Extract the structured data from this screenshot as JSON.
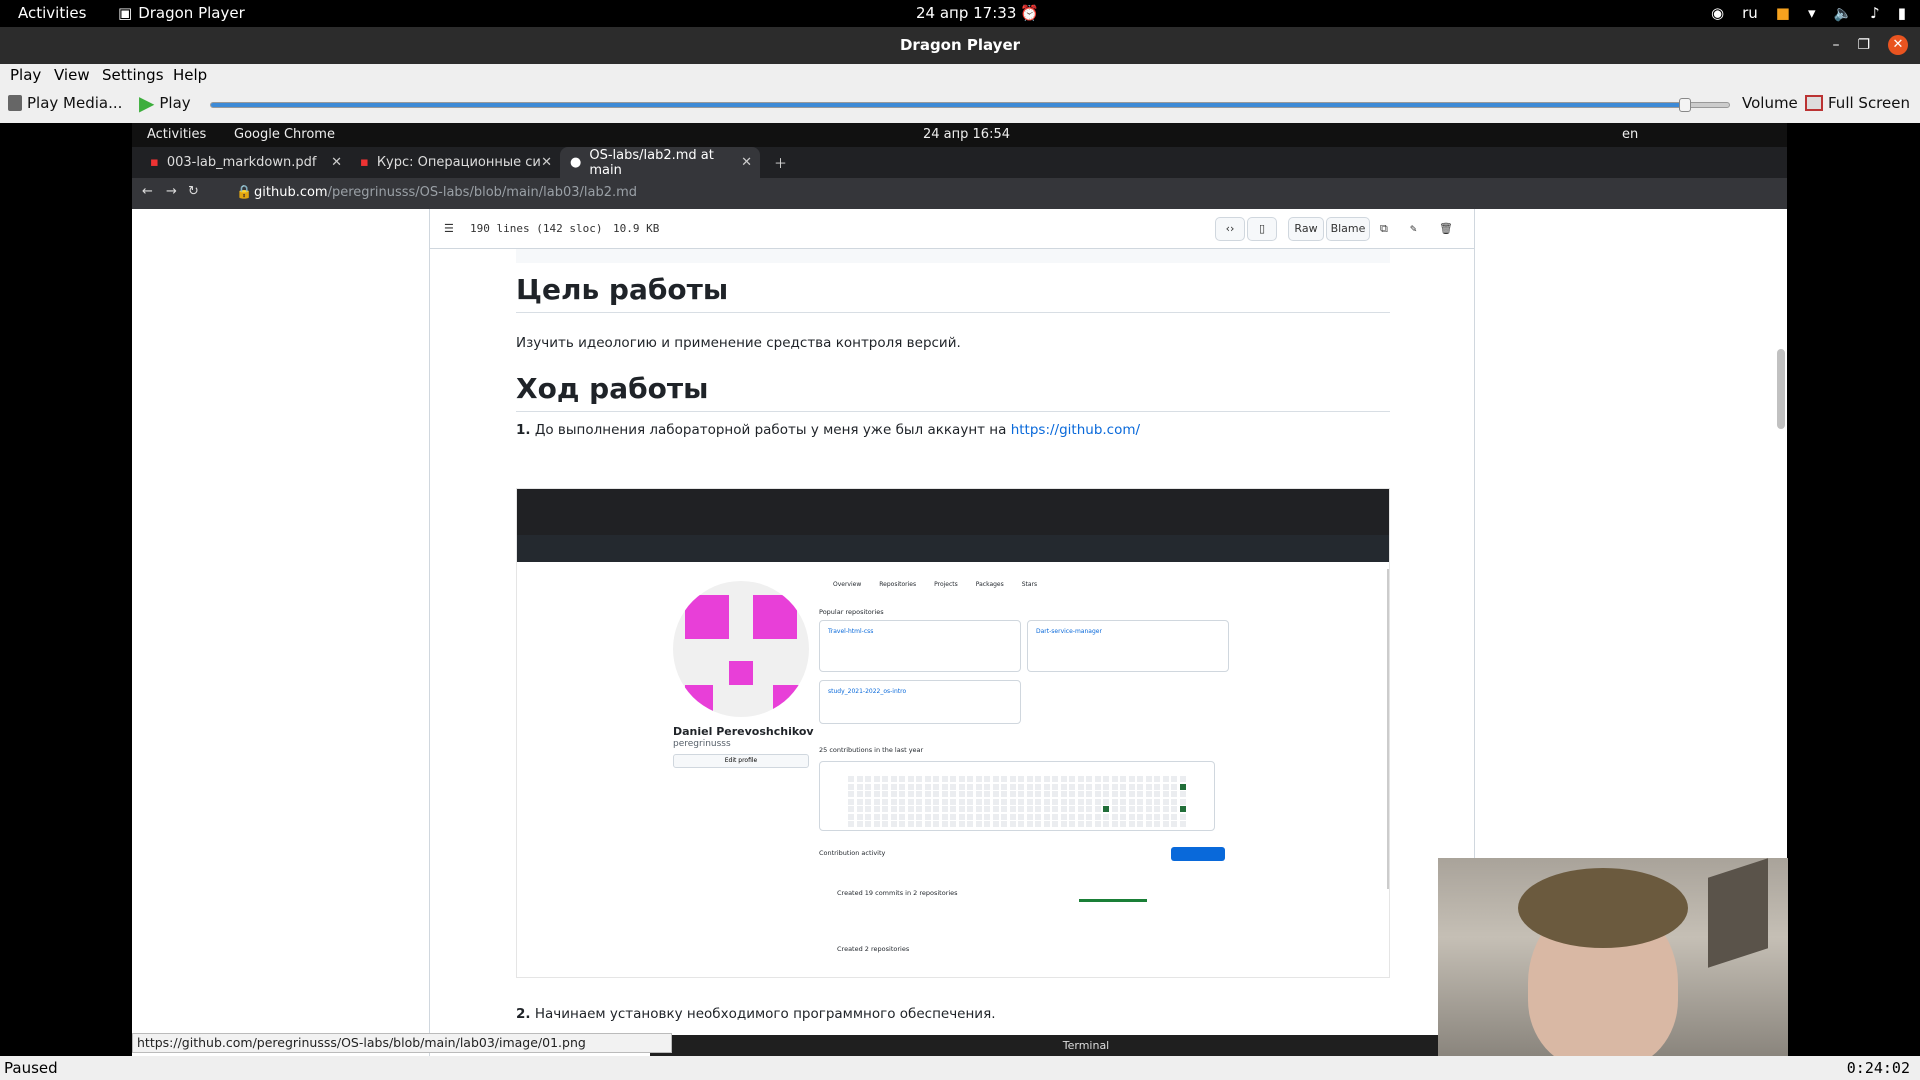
{
  "system": {
    "activities": "Activities",
    "app_name": "Dragon Player",
    "clock": "24 апр  17:33",
    "lang": "ru"
  },
  "window": {
    "title": "Dragon Player"
  },
  "menu": {
    "play": "Play",
    "view": "View",
    "settings": "Settings",
    "help": "Help"
  },
  "toolbar": {
    "play_media": "Play Media...",
    "play": "Play",
    "volume": "Volume",
    "fullscreen": "Full Screen",
    "seek_progress": 0.971
  },
  "status": {
    "state": "Paused",
    "time": "0:24:02"
  },
  "video": {
    "system": {
      "activities": "Activities",
      "browser": "Google Chrome",
      "clock": "24 апр  16:54",
      "lang": "en"
    },
    "tabs": [
      {
        "label": "003-lab_markdown.pdf"
      },
      {
        "label": "Курс: Операционные си"
      },
      {
        "label": "OS-labs/lab2.md at main"
      }
    ],
    "url": {
      "host": "github.com",
      "path": "/peregrinusss/OS-labs/blob/main/lab03/lab2.md"
    },
    "file": {
      "lines": "190 lines (142 sloc)",
      "size": "10.9 KB",
      "raw": "Raw",
      "blame": "Blame"
    },
    "doc": {
      "h_goal": "Цель работы",
      "goal_text": "Изучить идеологию и применение средства контроля версий.",
      "h_progress": "Ход работы",
      "step1_num": "1.",
      "step1_text": "До выполнения лабораторной работы у меня уже был аккаунт на",
      "step1_link": "https://github.com/",
      "step2_num": "2.",
      "step2_text": "Начинаем установку необходимого программного обеспечения."
    },
    "screenshot": {
      "profile_name": "Daniel Perevoshchikov",
      "profile_login": "peregrinusss",
      "edit_profile": "Edit profile",
      "tab_overview": "Overview",
      "tab_repositories": "Repositories",
      "tab_projects": "Projects",
      "tab_packages": "Packages",
      "tab_stars": "Stars",
      "popular": "Popular repositories",
      "repos": [
        "Travel-html-css",
        "Dart-service-manager",
        "study_2021-2022_os-intro"
      ],
      "contributions": "25 contributions in the last year",
      "activity": "Contribution activity",
      "created_commits": "Created 19 commits in 2 repositories",
      "created_repos": "Created 2 repositories"
    },
    "tooltip": "https://github.com/peregrinusss/OS-labs/blob/main/lab03/image/01.png",
    "terminal_title": "Terminal"
  }
}
